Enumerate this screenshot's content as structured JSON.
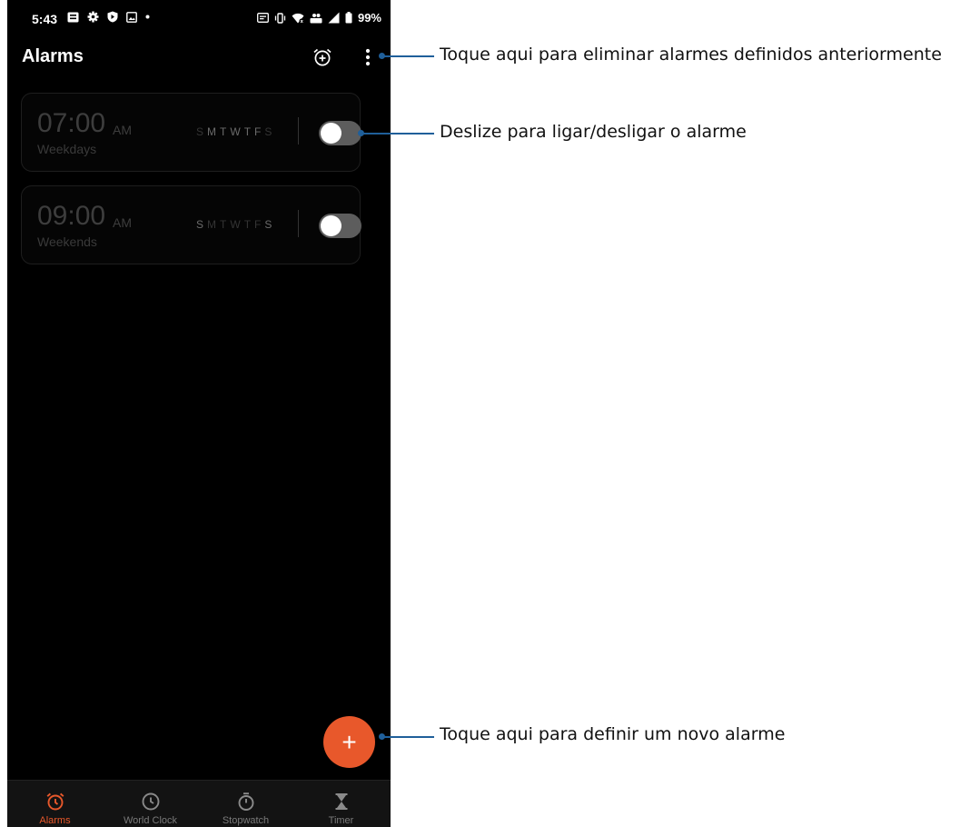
{
  "status_bar": {
    "time": "5:43",
    "battery": "99%"
  },
  "app_bar": {
    "title": "Alarms"
  },
  "alarms": [
    {
      "time": "07:00",
      "ampm": "AM",
      "label": "Weekdays",
      "days": [
        "S",
        "M",
        "T",
        "W",
        "T",
        "F",
        "S"
      ],
      "active_days": [
        false,
        true,
        true,
        true,
        true,
        true,
        false
      ],
      "enabled": false
    },
    {
      "time": "09:00",
      "ampm": "AM",
      "label": "Weekends",
      "days": [
        "S",
        "M",
        "T",
        "W",
        "T",
        "F",
        "S"
      ],
      "active_days": [
        true,
        false,
        false,
        false,
        false,
        false,
        true
      ],
      "enabled": false
    }
  ],
  "fab": {
    "icon": "plus-icon",
    "label": "+"
  },
  "bottom_nav": [
    {
      "label": "Alarms",
      "icon": "alarm-icon",
      "active": true
    },
    {
      "label": "World Clock",
      "icon": "clock-icon",
      "active": false
    },
    {
      "label": "Stopwatch",
      "icon": "stopwatch-icon",
      "active": false
    },
    {
      "label": "Timer",
      "icon": "hourglass-icon",
      "active": false
    }
  ],
  "annotations": {
    "menu": "Toque aqui para eliminar alarmes definidos anteriormente",
    "toggle": "Deslize para ligar/desligar o alarme",
    "fab": "Toque aqui para definir um novo alarme"
  },
  "colors": {
    "accent": "#e8582b",
    "leader": "#1f5f9a",
    "background": "#000000"
  }
}
